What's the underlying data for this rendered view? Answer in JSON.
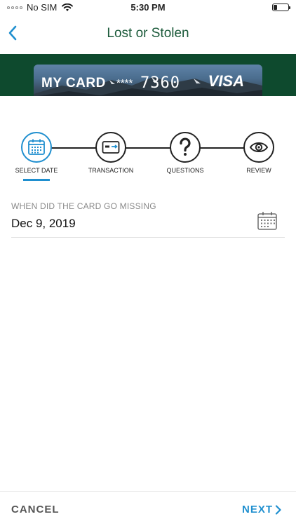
{
  "status_bar": {
    "carrier": "No SIM",
    "time": "5:30 PM",
    "icons": [
      "signal-dots-icon",
      "wifi-icon",
      "battery-icon"
    ]
  },
  "nav": {
    "title": "Lost or Stolen",
    "back_icon": "chevron-left-icon"
  },
  "card": {
    "name": "MY CARD",
    "masked": "****",
    "last_digits": "7360",
    "brand": "VISA"
  },
  "steps": [
    {
      "label": "SELECT DATE",
      "icon": "calendar-icon",
      "active": true
    },
    {
      "label": "TRANSACTION",
      "icon": "credit-card-icon",
      "active": false
    },
    {
      "label": "QUESTIONS",
      "icon": "question-mark-icon",
      "active": false
    },
    {
      "label": "REVIEW",
      "icon": "eye-icon",
      "active": false
    }
  ],
  "date_field": {
    "label": "WHEN DID THE CARD GO MISSING",
    "value": "Dec 9, 2019",
    "icon": "calendar-icon"
  },
  "footer": {
    "cancel_label": "CANCEL",
    "next_label": "NEXT"
  },
  "colors": {
    "accent": "#1f8fcf",
    "brand_green": "#0e4a2e",
    "title_green": "#1b5a3a"
  }
}
